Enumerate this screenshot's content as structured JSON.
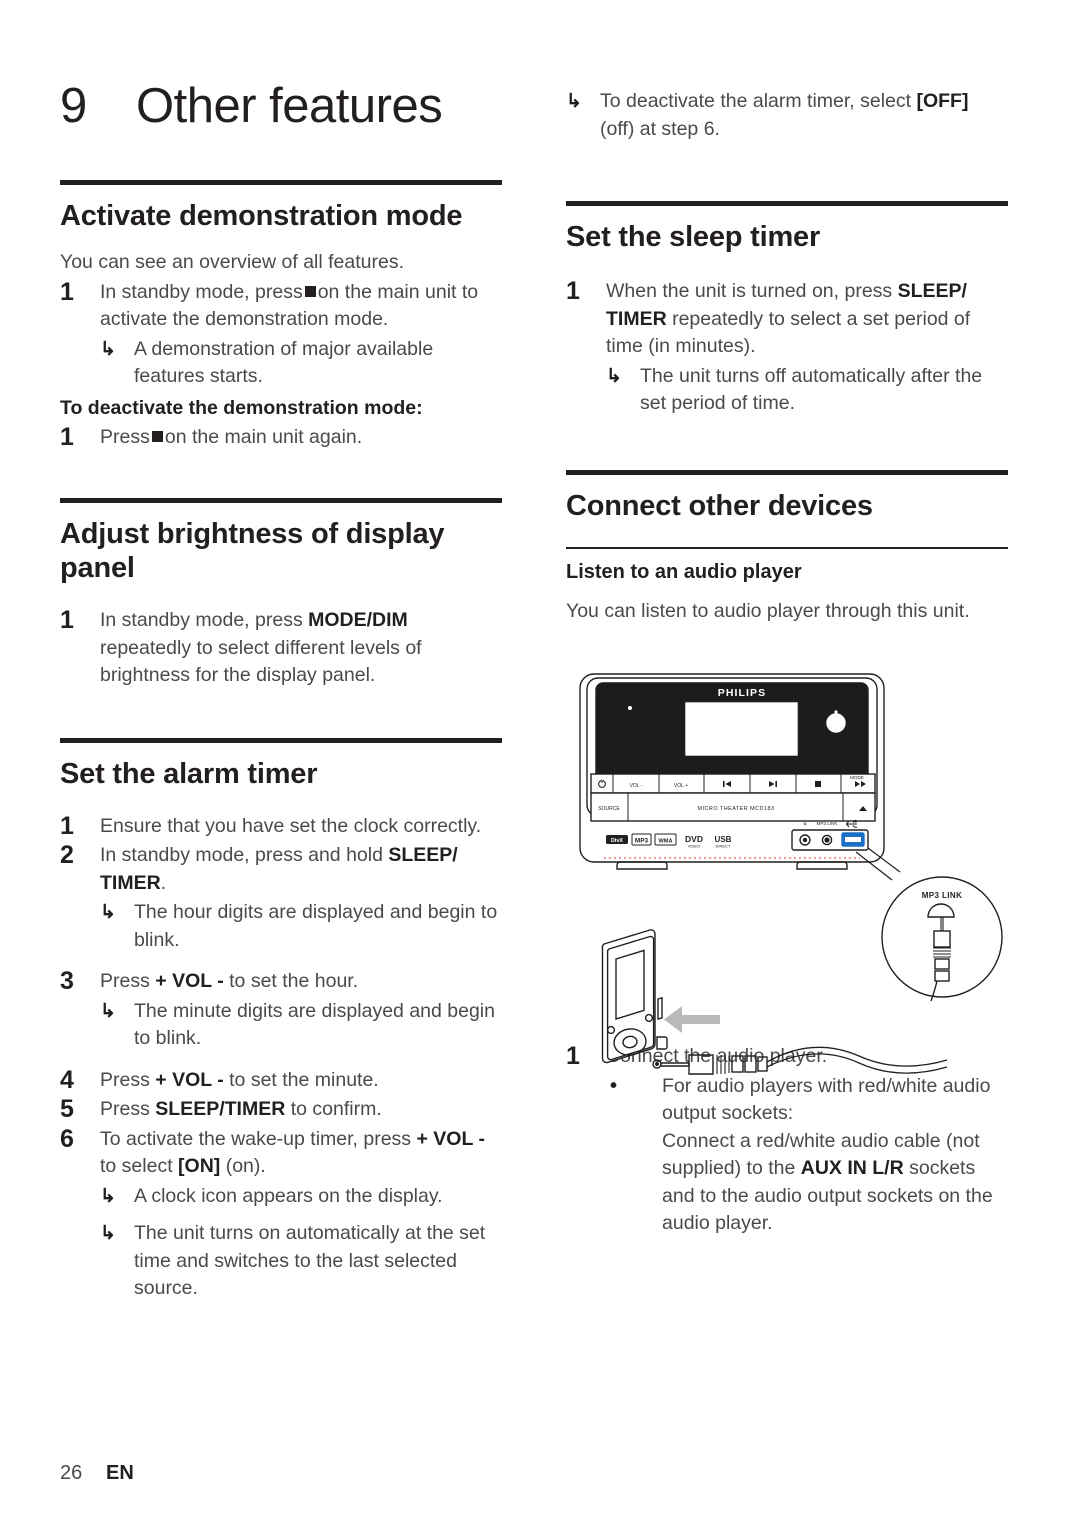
{
  "page": {
    "chapter_number": "9",
    "chapter_title": "Other features",
    "footer_page": "26",
    "footer_lang": "EN"
  },
  "left_column": {
    "section_demo": {
      "heading": "Activate demonstration mode",
      "lead": "You can see an overview of all features.",
      "step1_num": "1",
      "step1_pre": "In standby mode, press",
      "step1_post": "on the main unit to activate the demonstration mode.",
      "result1_mark": "↳",
      "result1_text": "A demonstration of major available features starts.",
      "deactivate_heading": "To deactivate the demonstration mode:",
      "step2_num": "1",
      "step2_pre": "Press",
      "step2_post": "on the main unit again."
    },
    "section_brightness": {
      "heading": "Adjust brightness of display panel",
      "step1_num": "1",
      "step1_a": "In standby mode, press ",
      "step1_bold": "MODE/DIM",
      "step1_b": " repeatedly to select different levels of brightness for the display panel."
    },
    "section_alarm": {
      "heading": "Set the alarm timer",
      "step1_num": "1",
      "step1_text": "Ensure that you have set the clock correctly.",
      "step2_num": "2",
      "step2_a": "In standby mode, press and hold ",
      "step2_bold": "SLEEP/ TIMER",
      "step2_b": ".",
      "result2_mark": "↳",
      "result2_text": "The hour digits are displayed and begin to blink.",
      "step3_num": "3",
      "step3_a": "Press ",
      "step3_bold": "+ VOL -",
      "step3_b": " to set the hour.",
      "result3_mark": "↳",
      "result3_text": "The minute digits are displayed and begin to blink.",
      "step4_num": "4",
      "step4_a": "Press ",
      "step4_bold": "+ VOL -",
      "step4_b": " to set the minute.",
      "step5_num": "5",
      "step5_a": "Press ",
      "step5_bold": "SLEEP/TIMER",
      "step5_b": " to confirm.",
      "step6_num": "6",
      "step6_a": "To activate the wake-up timer, press ",
      "step6_bold": "+ VOL -",
      "step6_b": " to select ",
      "step6_bold2": "[ON]",
      "step6_c": " (on).",
      "result6a_mark": "↳",
      "result6a_text": "A clock icon appears on the display.",
      "result6b_mark": "↳",
      "result6b_text": "The unit turns on automatically at the set time and switches to the last selected source."
    }
  },
  "right_column": {
    "carryover_result": {
      "mark": "↳",
      "text_a": "To deactivate the alarm timer, select ",
      "text_bold": "[OFF]",
      "text_b": " (off) at step 6."
    },
    "section_sleep": {
      "heading": "Set the sleep timer",
      "step1_num": "1",
      "step1_a": "When the unit is turned on, press ",
      "step1_bold": "SLEEP/ TIMER",
      "step1_b": " repeatedly to select a set period of time (in minutes).",
      "result1_mark": "↳",
      "result1_text": "The unit turns off automatically after the set period of time."
    },
    "section_connect": {
      "heading": "Connect other devices",
      "sub_heading": "Listen to an audio player",
      "lead": "You can listen to audio player through this unit.",
      "step1_num": "1",
      "step1_text": "Connect the audio player.",
      "bullet_mark": "•",
      "bullet_a": "For audio players with red/white audio output sockets:",
      "bullet_b": "Connect a red/white audio cable (not supplied) to the ",
      "bullet_bold": "AUX IN L/R",
      "bullet_c": " sockets and to the audio output sockets on the audio player."
    }
  },
  "illustration": {
    "brand": "PHILIPS",
    "model_label": "MICRO THEATER MCD183",
    "source_button": "SOURCE",
    "button_labels": [
      "VOL -",
      "VOL +",
      "MODE"
    ],
    "jack_label_headphone": "headphone-jack",
    "jack_label_mp3": "MP3 LINK",
    "jack_label_usb": "usb-port",
    "callout_label": "MP3 LINK",
    "logos": [
      "DivX",
      "MP3",
      "WMA",
      "DVD VIDEO",
      "DIRECT"
    ],
    "accent_usb_color": "#1b6fc4",
    "arrow_color": "#b9b9bb"
  }
}
